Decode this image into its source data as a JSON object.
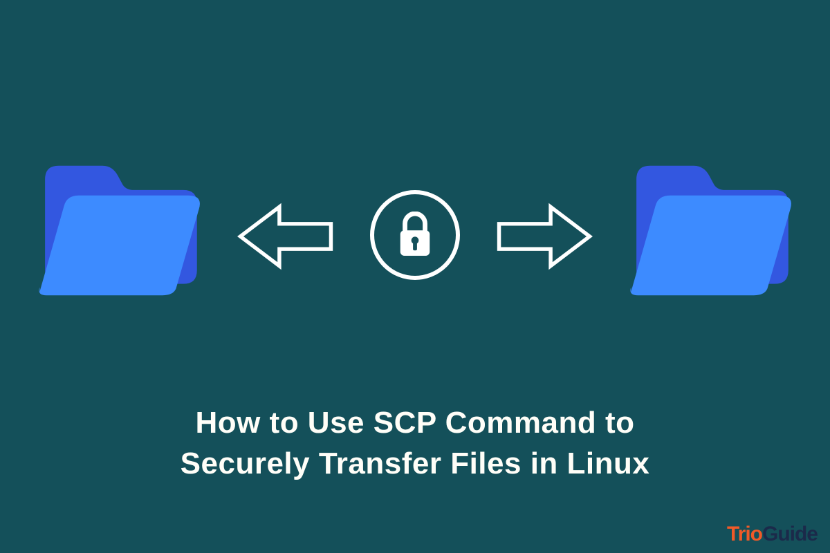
{
  "colors": {
    "background": "#14505a",
    "folder_back": "#3357e0",
    "folder_front": "#3d8bff",
    "outline": "#ffffff",
    "text": "#fffef8",
    "brand_primary": "#f05a28",
    "brand_secondary": "#1b2a4a"
  },
  "icons": {
    "left_folder": "folder-open",
    "right_folder": "folder-open",
    "center": "padlock",
    "left_arrow": "arrow-left-outline",
    "right_arrow": "arrow-right-outline"
  },
  "headline": {
    "line1": "How to Use SCP Command to",
    "line2": "Securely Transfer Files in Linux"
  },
  "brand": {
    "part1": "Trio",
    "part2": "Guide"
  }
}
